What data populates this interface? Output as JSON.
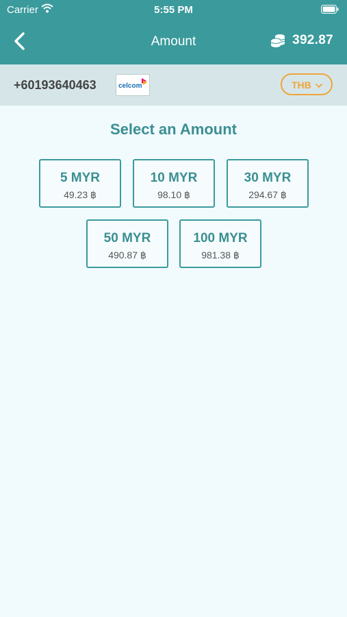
{
  "status_bar": {
    "carrier": "Carrier",
    "time": "5:55 PM"
  },
  "nav": {
    "title": "Amount",
    "balance": "392.87"
  },
  "phone": {
    "number": "+60193640463",
    "operator_logo_text": "celcom"
  },
  "currency": {
    "selected": "THB"
  },
  "section": {
    "title": "Select an Amount"
  },
  "amounts": [
    {
      "label": "5 MYR",
      "converted": "49.23 ฿"
    },
    {
      "label": "10 MYR",
      "converted": "98.10 ฿"
    },
    {
      "label": "30 MYR",
      "converted": "294.67 ฿"
    },
    {
      "label": "50 MYR",
      "converted": "490.87 ฿"
    },
    {
      "label": "100 MYR",
      "converted": "981.38 ฿"
    }
  ],
  "colors": {
    "header": "#3a9a9c",
    "accent": "#3a8f92",
    "currency_accent": "#f0a43b",
    "background": "#f1fafd"
  }
}
